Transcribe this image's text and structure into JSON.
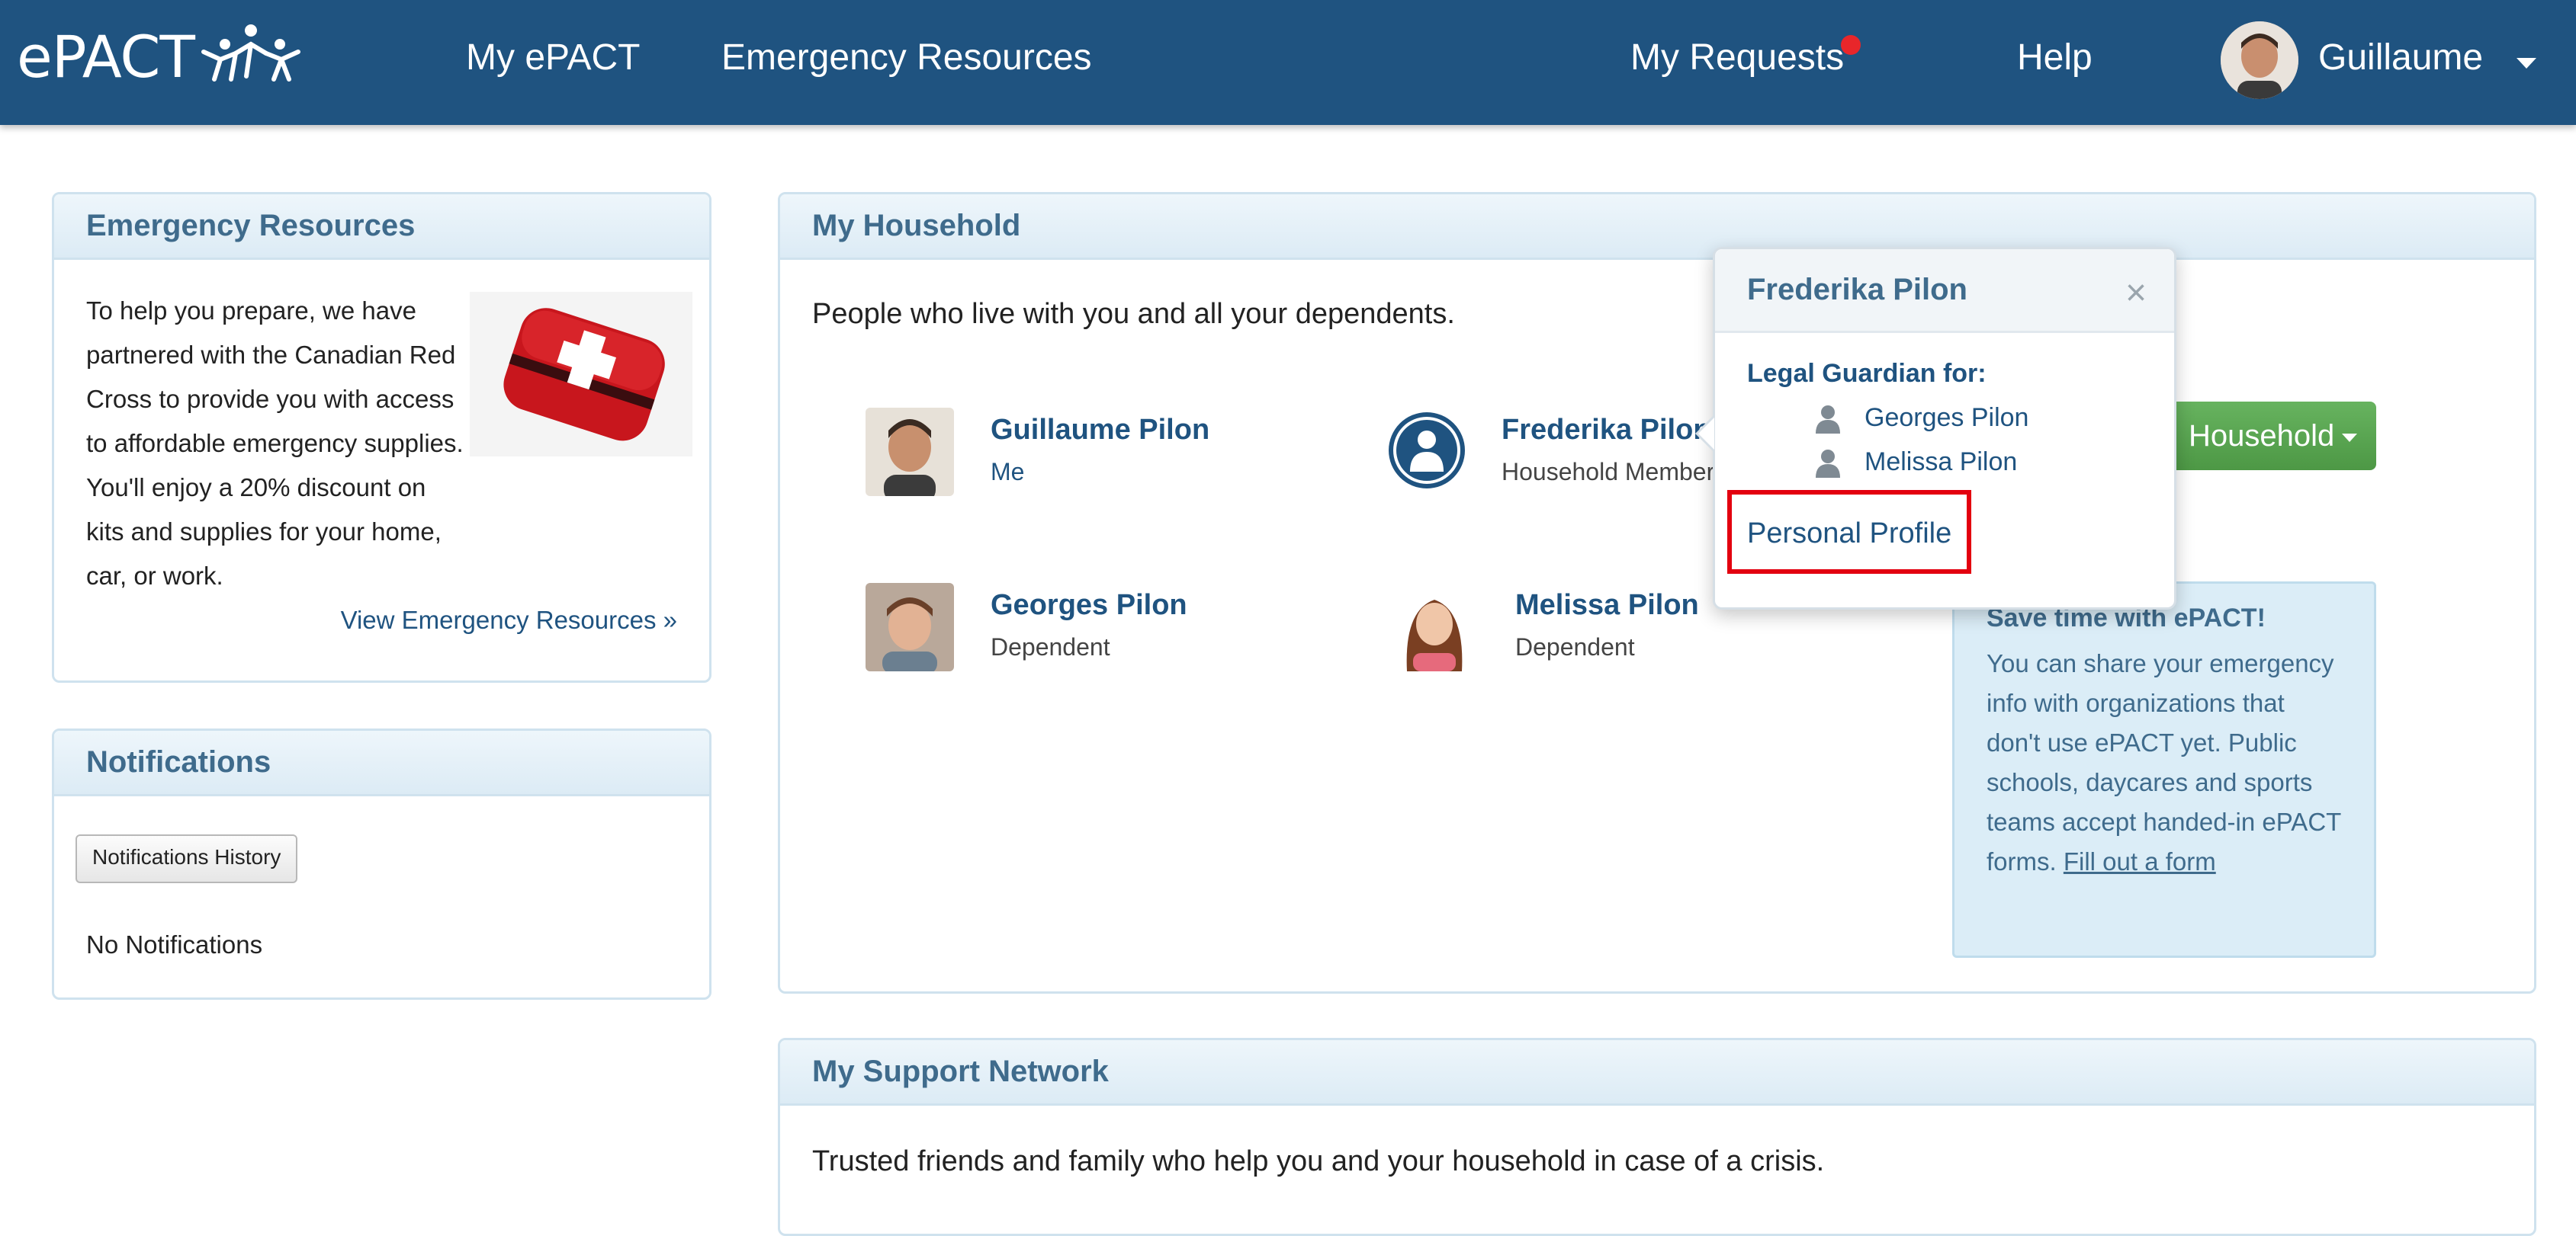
{
  "nav": {
    "logo": "ePACT",
    "links": [
      "My ePACT",
      "Emergency Resources"
    ],
    "my_requests": "My Requests",
    "help": "Help",
    "user_name": "Guillaume",
    "accent": "#1f5380",
    "notification_dot_color": "#e8262a"
  },
  "emergency_resources": {
    "title": "Emergency Resources",
    "body": "To help you prepare, we have partnered with the Canadian Red Cross to provide you with access to affordable emergency supplies. You'll enjoy a 20% discount on kits and supplies for your home, car, or work.",
    "link": "View Emergency Resources »"
  },
  "notifications": {
    "title": "Notifications",
    "history_button": "Notifications History",
    "empty_text": "No Notifications"
  },
  "household": {
    "title": "My Household",
    "intro": "People who live with you and all your dependents.",
    "members": [
      {
        "name": "Guillaume Pilon",
        "role": "Me"
      },
      {
        "name": "Frederika Pilon",
        "role": "Household Member"
      },
      {
        "name": "Georges Pilon",
        "role": "Dependent"
      },
      {
        "name": "Melissa Pilon",
        "role": "Dependent"
      }
    ],
    "household_button": "Household",
    "save_box": {
      "title": "Save time with ePACT!",
      "text": "You can share your emergency info with organizations that don't use ePACT yet. Public schools, daycares and sports teams accept handed-in ePACT forms.",
      "link": "Fill out a form"
    }
  },
  "popover": {
    "title": "Frederika Pilon",
    "close": "×",
    "guardian_label": "Legal Guardian for:",
    "dependents": [
      "Georges Pilon",
      "Melissa Pilon"
    ],
    "profile_link": "Personal Profile"
  },
  "support_network": {
    "title": "My Support Network",
    "intro": "Trusted friends and family who help you and your household in case of a crisis."
  }
}
